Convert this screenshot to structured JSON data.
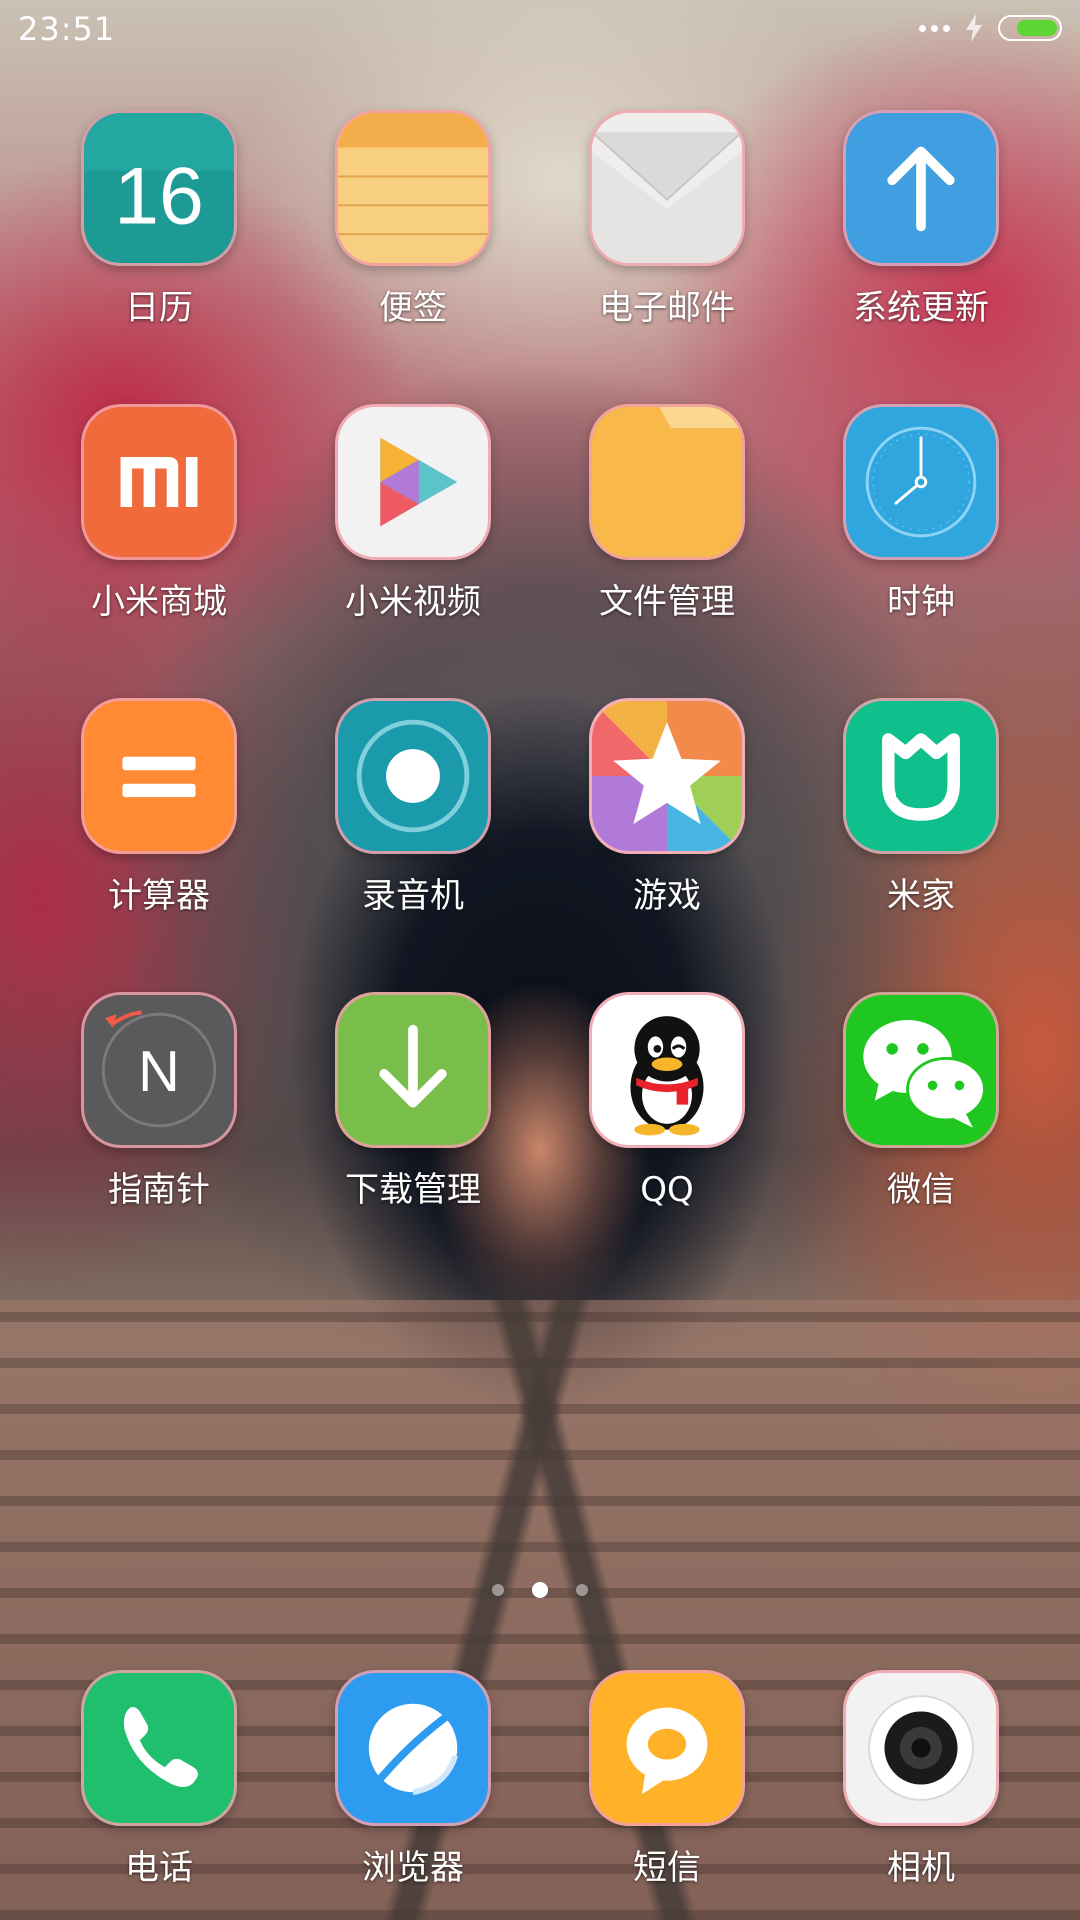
{
  "status_bar": {
    "time": "23:51"
  },
  "pages": {
    "count": 3,
    "active_index": 1
  },
  "apps": [
    {
      "label": "日历",
      "icon": "calendar-icon",
      "badge_text": "16",
      "color": "#1e9a94"
    },
    {
      "label": "便签",
      "icon": "notes-icon",
      "color": "#f5be64"
    },
    {
      "label": "电子邮件",
      "icon": "email-icon",
      "color": "#f0efee"
    },
    {
      "label": "系统更新",
      "icon": "system-update-icon",
      "color": "#3f9fe0"
    },
    {
      "label": "小米商城",
      "icon": "mi-store-icon",
      "color": "#f06a3c"
    },
    {
      "label": "小米视频",
      "icon": "mi-video-icon",
      "color": "#f2f2f2"
    },
    {
      "label": "文件管理",
      "icon": "file-manager-icon",
      "color": "#f8b84a"
    },
    {
      "label": "时钟",
      "icon": "clock-icon",
      "color": "#2fa6de"
    },
    {
      "label": "计算器",
      "icon": "calculator-icon",
      "color": "#ff8a33"
    },
    {
      "label": "录音机",
      "icon": "recorder-icon",
      "color": "#1b9aac"
    },
    {
      "label": "游戏",
      "icon": "game-icon",
      "color": "#ffffff"
    },
    {
      "label": "米家",
      "icon": "mijia-icon",
      "color": "#0fbf8c"
    },
    {
      "label": "指南针",
      "icon": "compass-icon",
      "color": "#5a5a5c"
    },
    {
      "label": "下载管理",
      "icon": "download-manager-icon",
      "color": "#79bd4a"
    },
    {
      "label": "QQ",
      "icon": "qq-icon",
      "color": "#ffffff"
    },
    {
      "label": "微信",
      "icon": "wechat-icon",
      "color": "#20c721"
    }
  ],
  "dock": [
    {
      "label": "电话",
      "icon": "phone-icon",
      "color": "#1fbf6e"
    },
    {
      "label": "浏览器",
      "icon": "browser-icon",
      "color": "#2d9cf0"
    },
    {
      "label": "短信",
      "icon": "messages-icon",
      "color": "#ffb127"
    },
    {
      "label": "相机",
      "icon": "camera-icon",
      "color": "#f2f2f2"
    }
  ]
}
